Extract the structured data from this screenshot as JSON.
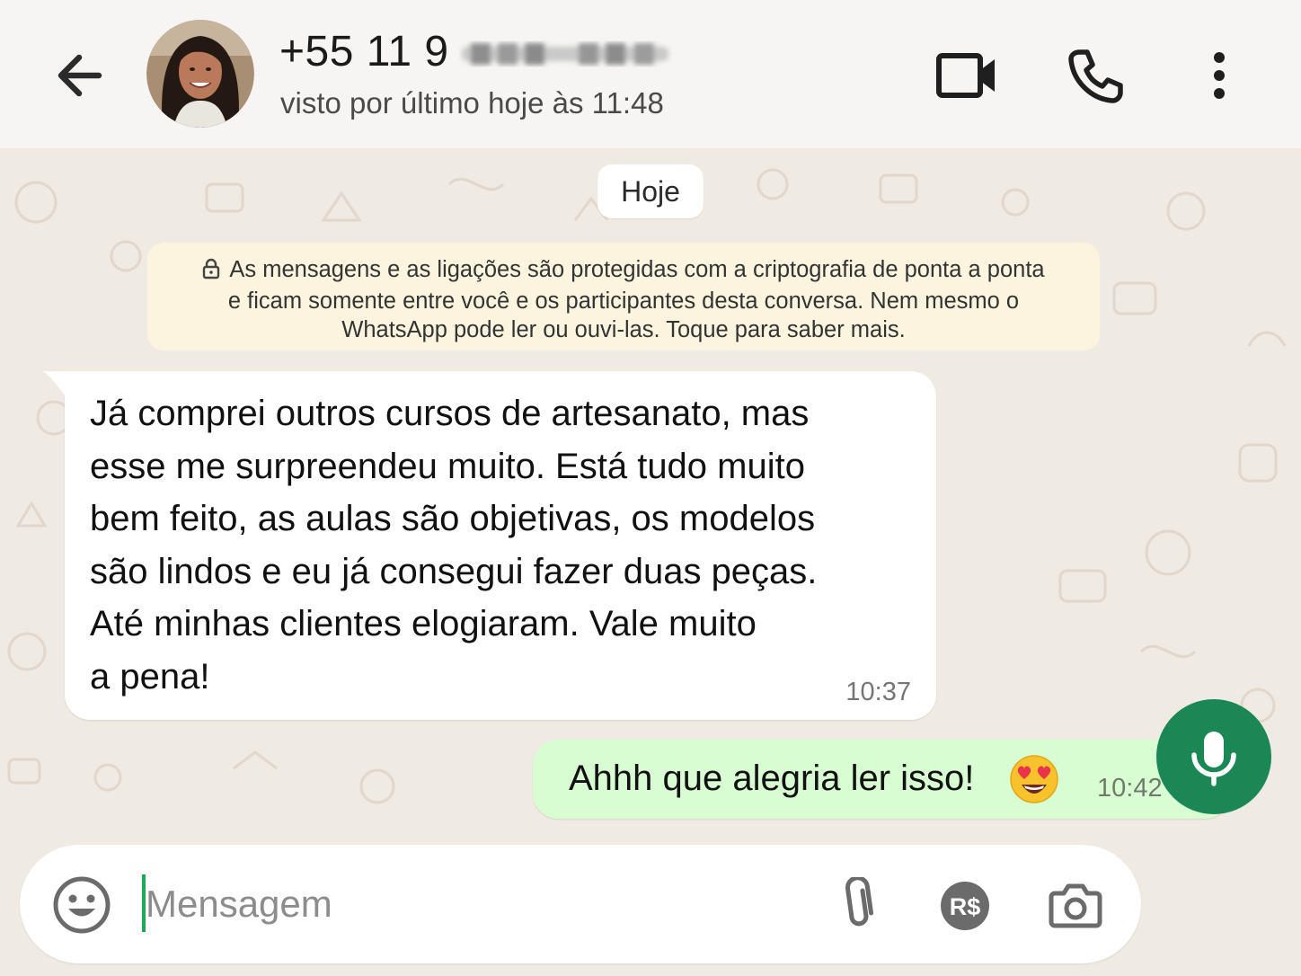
{
  "header": {
    "contact_name": "+55 11 9",
    "last_seen": "visto por último hoje às 11:48",
    "icons": {
      "back": "arrow-left-icon",
      "video": "video-call-icon",
      "call": "phone-icon",
      "menu": "more-vertical-icon"
    }
  },
  "chat": {
    "date_label": "Hoje",
    "encryption_notice": {
      "line1": "As mensagens e as ligações são protegidas com a criptografia de ponta a ponta",
      "line2": "e ficam somente entre você e os participantes desta conversa. Nem mesmo o",
      "line3": "WhatsApp pode ler ou ouvi-las. Toque para saber mais."
    },
    "messages": [
      {
        "direction": "incoming",
        "lines": [
          "Já comprei outros cursos de artesanato, mas",
          "esse me surpreendeu muito. Está tudo muito",
          "bem feito, as aulas são objetivas, os modelos",
          "são lindos e eu já consegui fazer duas peças.",
          "Até minhas clientes elogiaram. Vale muito",
          "a pena!"
        ],
        "time": "10:37"
      },
      {
        "direction": "outgoing",
        "text": "Ahhh que alegria ler isso!",
        "emoji": "heart-eyes-emoji",
        "time": "10:42",
        "status": "read"
      }
    ]
  },
  "composer": {
    "placeholder": "Mensagem",
    "value": "",
    "icons": {
      "emoji": "emoji-icon",
      "attach": "paperclip-icon",
      "payment": "payment-icon",
      "payment_label": "R$",
      "camera": "camera-icon",
      "mic": "microphone-icon"
    }
  },
  "colors": {
    "header_bg": "#f6f5f3",
    "chat_bg": "#efeae2",
    "outgoing_bubble": "#d9fdd3",
    "notice_bg": "#fcf4de",
    "accent_green": "#1b8755",
    "read_ticks": "#1e88e5"
  }
}
